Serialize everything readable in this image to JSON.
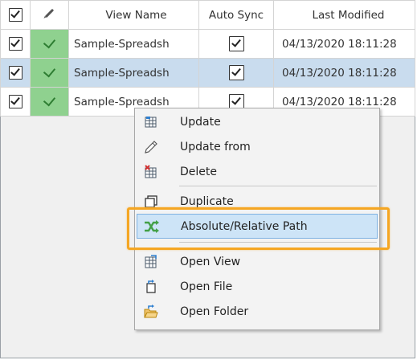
{
  "grid": {
    "headers": {
      "view_name": "View Name",
      "auto_sync": "Auto Sync",
      "last_modified": "Last Modified"
    },
    "rows": [
      {
        "name": "Sample-Spreadsh",
        "modified": "04/13/2020 18:11:28",
        "selected": false
      },
      {
        "name": "Sample-Spreadsh",
        "modified": "04/13/2020 18:11:28",
        "selected": true
      },
      {
        "name": "Sample-Spreadsh",
        "modified": "04/13/2020 18:11:28",
        "selected": false
      }
    ]
  },
  "context_menu": {
    "items": [
      {
        "label": "Update",
        "icon": "update-grid-icon"
      },
      {
        "label": "Update from",
        "icon": "pencil-icon"
      },
      {
        "label": "Delete",
        "icon": "delete-grid-icon"
      },
      {
        "label": "Duplicate",
        "icon": "duplicate-icon"
      },
      {
        "label": "Absolute/Relative Path",
        "icon": "shuffle-arrows-icon",
        "highlighted": true
      },
      {
        "label": "Open View",
        "icon": "open-view-icon"
      },
      {
        "label": "Open File",
        "icon": "open-file-icon"
      },
      {
        "label": "Open Folder",
        "icon": "open-folder-icon"
      }
    ]
  },
  "colors": {
    "highlight_border": "#f5a623",
    "selected_row": "#c9dcee",
    "ok_cell": "#8fd18f",
    "menu_hover": "#cde4f7"
  }
}
